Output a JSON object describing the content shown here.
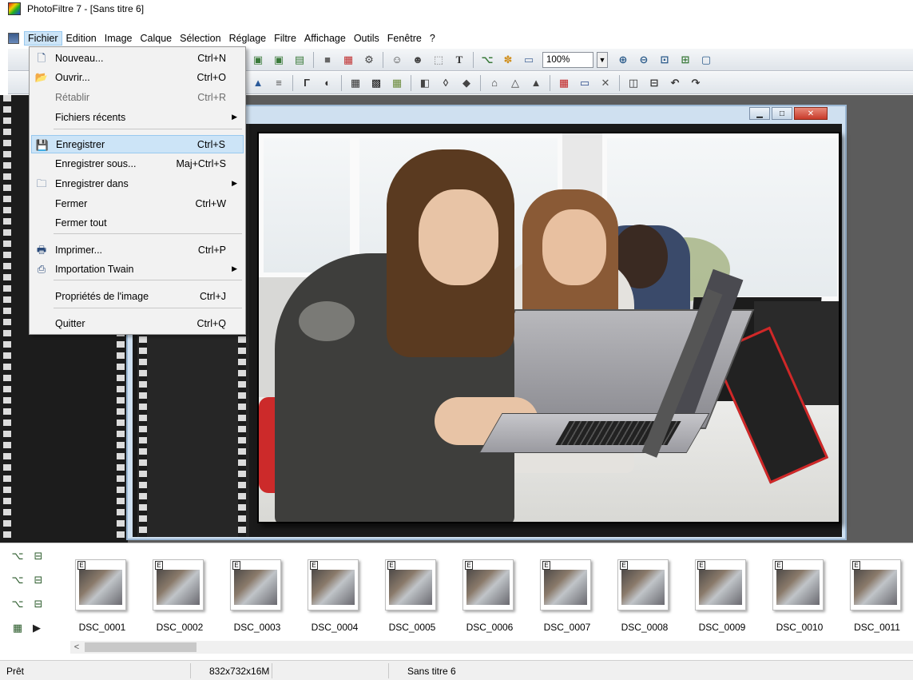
{
  "window": {
    "title": "PhotoFiltre 7 - [Sans titre 6]"
  },
  "menubar": {
    "items": [
      "Fichier",
      "Edition",
      "Image",
      "Calque",
      "Sélection",
      "Réglage",
      "Filtre",
      "Affichage",
      "Outils",
      "Fenêtre",
      "?"
    ],
    "active": "Fichier"
  },
  "toolbar": {
    "zoom": "100%"
  },
  "file_menu": {
    "items": [
      {
        "label": "Nouveau...",
        "shortcut": "Ctrl+N",
        "icon": "new-document-icon"
      },
      {
        "label": "Ouvrir...",
        "shortcut": "Ctrl+O",
        "icon": "open-folder-icon"
      },
      {
        "label": "Rétablir",
        "shortcut": "Ctrl+R",
        "disabled": true
      },
      {
        "label": "Fichiers récents",
        "shortcut": "",
        "submenu": true
      },
      {
        "label": "Enregistrer",
        "shortcut": "Ctrl+S",
        "icon": "save-icon",
        "highlighted": true
      },
      {
        "label": "Enregistrer sous...",
        "shortcut": "Maj+Ctrl+S"
      },
      {
        "label": "Enregistrer dans",
        "shortcut": "",
        "submenu": true,
        "icon": "save-to-folder-icon"
      },
      {
        "label": "Fermer",
        "shortcut": "Ctrl+W"
      },
      {
        "label": "Fermer tout",
        "shortcut": ""
      },
      {
        "label": "Imprimer...",
        "shortcut": "Ctrl+P",
        "icon": "printer-icon"
      },
      {
        "label": "Importation Twain",
        "shortcut": "",
        "submenu": true,
        "icon": "scanner-icon"
      },
      {
        "label": "Propriétés de l'image",
        "shortcut": "Ctrl+J"
      },
      {
        "label": "Quitter",
        "shortcut": "Ctrl+Q"
      }
    ]
  },
  "thumbnails": [
    {
      "name": "DSC_0001"
    },
    {
      "name": "DSC_0002"
    },
    {
      "name": "DSC_0003"
    },
    {
      "name": "DSC_0004"
    },
    {
      "name": "DSC_0005"
    },
    {
      "name": "DSC_0006"
    },
    {
      "name": "DSC_0007"
    },
    {
      "name": "DSC_0008"
    },
    {
      "name": "DSC_0009"
    },
    {
      "name": "DSC_0010"
    },
    {
      "name": "DSC_0011"
    }
  ],
  "thumb_badge": "E",
  "statusbar": {
    "status": "Prêt",
    "image_info": "832x732x16M",
    "document": "Sans titre 6"
  },
  "colors": {
    "menu_highlight": "#cce4f7",
    "workspace": "#5c5c5c",
    "doc_frame": "#cfe0f0"
  }
}
